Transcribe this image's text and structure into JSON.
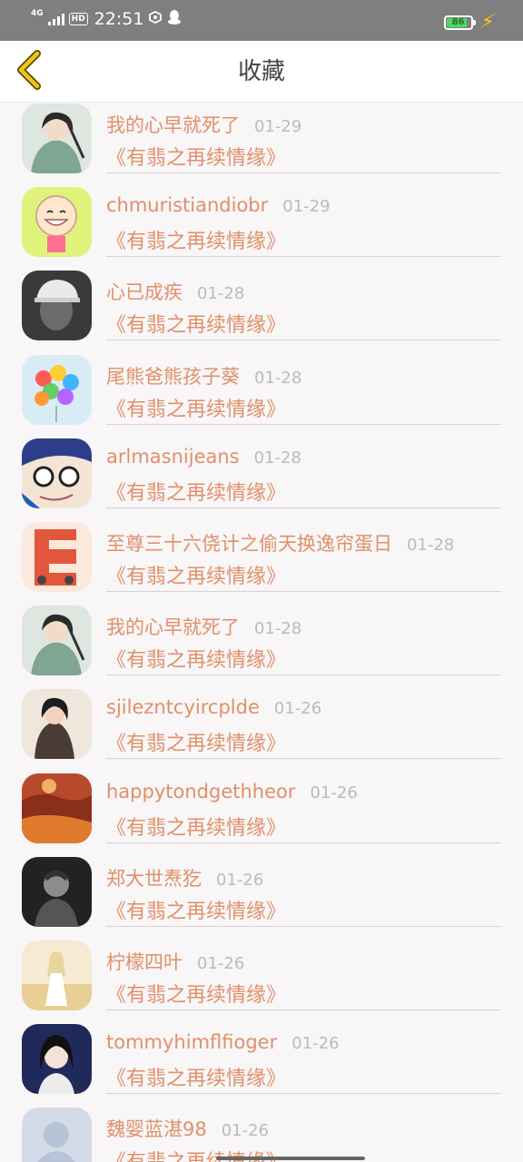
{
  "status_bar": {
    "network": "4G",
    "hd": "HD",
    "time": "22:51",
    "battery": "86",
    "battery_level": 0.86,
    "icons": [
      "signal-icon",
      "hd-icon",
      "app-notification-icon",
      "qq-penguin-icon",
      "battery-icon",
      "charging-icon"
    ]
  },
  "header": {
    "title": "收藏",
    "back_icon": "chevron-left-icon",
    "accent": "#f0c419"
  },
  "colors": {
    "name": "#e0906a",
    "date": "#bbbbbb",
    "background": "#f8f6f7"
  },
  "items": [
    {
      "name": "我的心早就死了",
      "date": "01-29",
      "book": "《有翡之再续情缘》",
      "avatar": "anime-man-avatar"
    },
    {
      "name": "chmuristiandiobr",
      "date": "01-29",
      "book": "《有翡之再续情缘》",
      "avatar": "cartoon-smile-avatar"
    },
    {
      "name": "心已成疾",
      "date": "01-28",
      "book": "《有翡之再续情缘》",
      "avatar": "cap-person-avatar"
    },
    {
      "name": "尾熊爸熊孩子葵",
      "date": "01-28",
      "book": "《有翡之再续情缘》",
      "avatar": "balloons-avatar"
    },
    {
      "name": "arlmasnijeans",
      "date": "01-28",
      "book": "《有翡之再续情缘》",
      "avatar": "anime-glasses-avatar"
    },
    {
      "name": "至尊三十六侥计之偷天换逸帘蛋日",
      "date": "01-28",
      "book": "《有翡之再续情缘》",
      "avatar": "letter-e-avatar"
    },
    {
      "name": "我的心早就死了",
      "date": "01-28",
      "book": "《有翡之再续情缘》",
      "avatar": "anime-man-avatar"
    },
    {
      "name": "sjilezntcyircplde",
      "date": "01-26",
      "book": "《有翡之再续情缘》",
      "avatar": "girl-portrait-avatar"
    },
    {
      "name": "happytondgethheor",
      "date": "01-26",
      "book": "《有翡之再续情缘》",
      "avatar": "autumn-landscape-avatar"
    },
    {
      "name": "郑大世焘犵",
      "date": "01-26",
      "book": "《有翡之再续情缘》",
      "avatar": "bw-man-avatar"
    },
    {
      "name": "柠檬四叶",
      "date": "01-26",
      "book": "《有翡之再续情缘》",
      "avatar": "field-girl-avatar"
    },
    {
      "name": "tommyhimflfioger",
      "date": "01-26",
      "book": "《有翡之再续情缘》",
      "avatar": "dark-hair-girl-avatar"
    },
    {
      "name": "魏婴蓝湛98",
      "date": "01-26",
      "book": "《有翡之再续情缘》",
      "avatar": "default-user-avatar"
    }
  ]
}
